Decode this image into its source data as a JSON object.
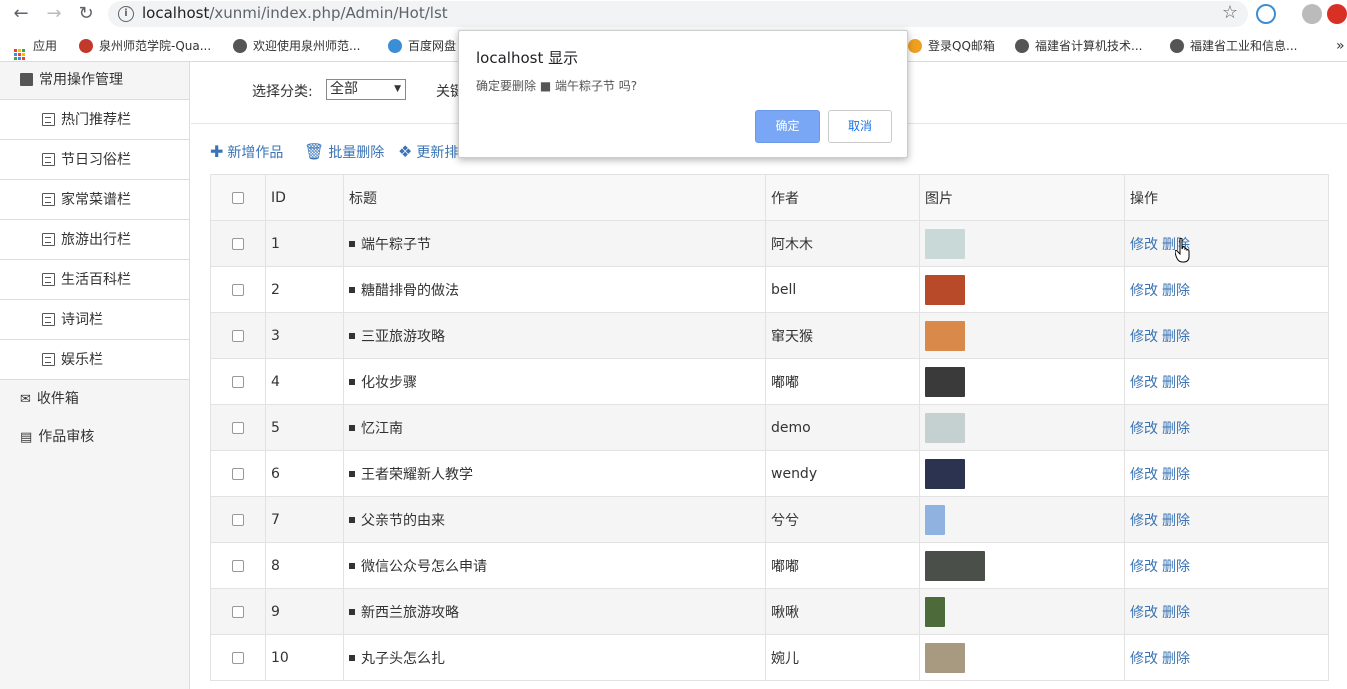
{
  "browser": {
    "url_host": "localhost",
    "url_path": "/xunmi/index.php/Admin/Hot/lst",
    "bookmarks": [
      "应用",
      "泉州师范学院-Qua...",
      "欢迎使用泉州师范...",
      "百度网盘",
      "登录QQ邮箱",
      "福建省计算机技术...",
      "福建省工业和信息..."
    ],
    "more": "»"
  },
  "sidebar": {
    "section_title": "常用操作管理",
    "sub_items": [
      "热门推荐栏",
      "节日习俗栏",
      "家常菜谱栏",
      "旅游出行栏",
      "生活百科栏",
      "诗词栏",
      "娱乐栏"
    ],
    "inbox": "收件箱",
    "review": "作品审核"
  },
  "filter": {
    "label": "选择分类:",
    "selected": "全部",
    "keyword_label": "关键"
  },
  "toolbar": {
    "add": "新增作品",
    "batch_delete": "批量删除",
    "update_sort": "更新排"
  },
  "table": {
    "headers": [
      "ID",
      "标题",
      "作者",
      "图片",
      "操作"
    ],
    "edit_label": "修改",
    "delete_label": "删除",
    "rows": [
      {
        "id": "1",
        "title": "端午粽子节",
        "author": "阿木木",
        "thumb_color": "#c9d9d8"
      },
      {
        "id": "2",
        "title": "糖醋排骨的做法",
        "author": "bell",
        "thumb_color": "#b84a2a"
      },
      {
        "id": "3",
        "title": "三亚旅游攻略",
        "author": "窜天猴",
        "thumb_color": "#d98a4a"
      },
      {
        "id": "4",
        "title": "化妆步骤",
        "author": "嘟嘟",
        "thumb_color": "#3a3a3a"
      },
      {
        "id": "5",
        "title": "忆江南",
        "author": "demo",
        "thumb_color": "#c5d0d0"
      },
      {
        "id": "6",
        "title": "王者荣耀新人教学",
        "author": "wendy",
        "thumb_color": "#2b3350"
      },
      {
        "id": "7",
        "title": "父亲节的由来",
        "author": "兮兮",
        "thumb_color": "#8fb2e0"
      },
      {
        "id": "8",
        "title": "微信公众号怎么申请",
        "author": "嘟嘟",
        "thumb_color": "#4a4f4a"
      },
      {
        "id": "9",
        "title": "新西兰旅游攻略",
        "author": "啾啾",
        "thumb_color": "#4d6a3a"
      },
      {
        "id": "10",
        "title": "丸子头怎么扎",
        "author": "婉儿",
        "thumb_color": "#a89a80"
      }
    ]
  },
  "dialog": {
    "title": "localhost 显示",
    "message": "确定要删除 ■ 端午粽子节 吗?",
    "ok": "确定",
    "cancel": "取消"
  }
}
